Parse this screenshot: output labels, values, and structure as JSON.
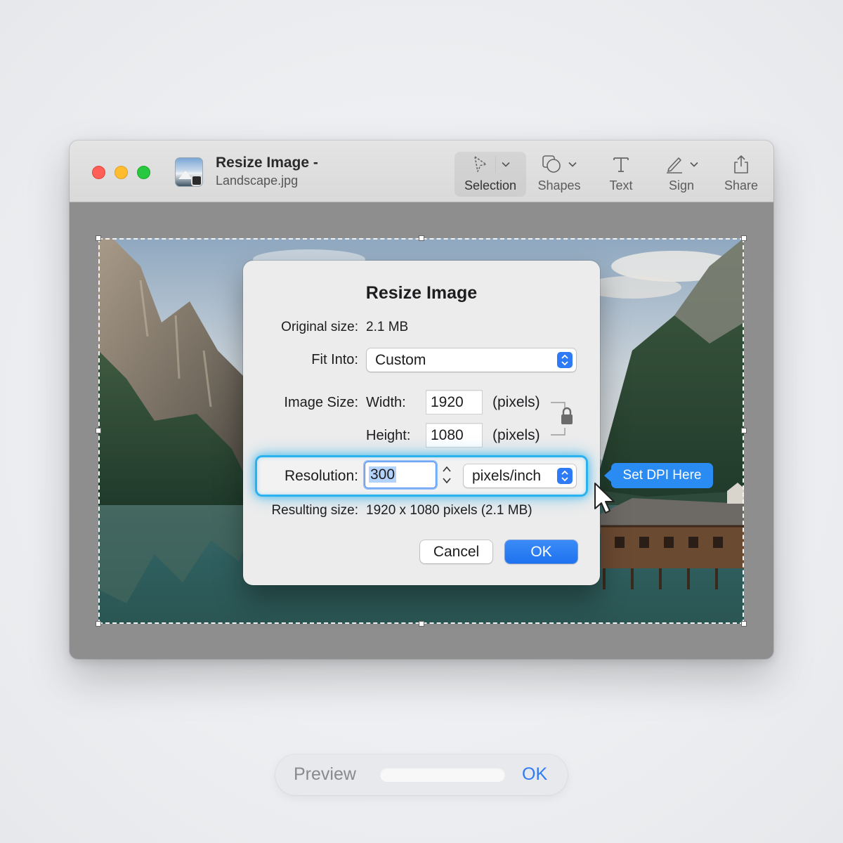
{
  "window": {
    "title": "Resize Image -",
    "subtitle": "Landscape.jpg"
  },
  "toolbar": {
    "items": [
      {
        "label": "Selection",
        "icon": "selection-arrow-icon"
      },
      {
        "label": "Shapes",
        "icon": "shapes-icon"
      },
      {
        "label": "Text",
        "icon": "text-icon"
      },
      {
        "label": "Sign",
        "icon": "signature-pen-icon"
      },
      {
        "label": "Share",
        "icon": "share-icon"
      }
    ],
    "selected": "Selection"
  },
  "dialog": {
    "title": "Resize Image",
    "original_size_label": "Original size:",
    "original_size_value": "2.1 MB",
    "fit_into_label": "Fit Into:",
    "fit_into_value": "Custom",
    "image_size_label": "Image Size:",
    "width_label": "Width:",
    "width_value": "1920",
    "width_unit": "(pixels)",
    "height_label": "Height:",
    "height_value": "1080",
    "height_unit": "(pixels)",
    "resolution_label": "Resolution:",
    "resolution_value": "300",
    "resolution_unit": "pixels/inch",
    "resulting_size_label": "Resulting size:",
    "resulting_size_value": "1920 x 1080 pixels (2.1 MB)",
    "cancel_label": "Cancel",
    "ok_label": "OK"
  },
  "callout": {
    "text": "Set DPI Here",
    "color": "#2a8cf2"
  },
  "bottom_bar": {
    "preview_label": "Preview",
    "ok_label": "OK"
  },
  "colors": {
    "accent": "#2f7bf5",
    "highlight": "#2ab2ef",
    "traffic_red": "#ff5f57",
    "traffic_yellow": "#febc2e",
    "traffic_green": "#28c840"
  }
}
